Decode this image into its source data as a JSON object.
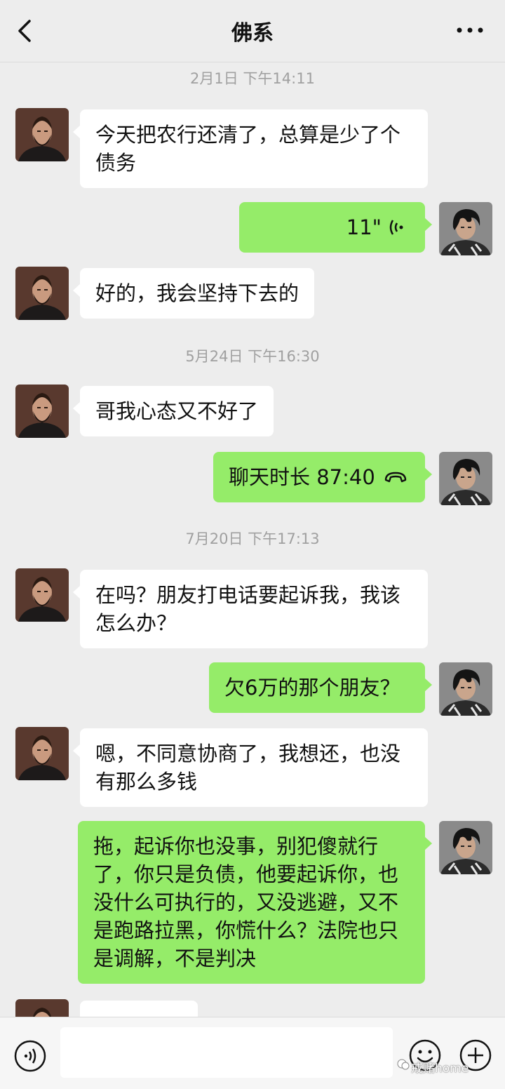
{
  "header": {
    "title": "佛系"
  },
  "timestamps": [
    "2月1日 下午14:11",
    "5月24日 下午16:30",
    "7月20日 下午17:13"
  ],
  "messages": [
    {
      "side": "in",
      "type": "text",
      "text": "今天把农行还清了，总算是少了个债务"
    },
    {
      "side": "out",
      "type": "voice",
      "duration": "11\""
    },
    {
      "side": "in",
      "type": "text",
      "text": "好的，我会坚持下去的"
    },
    {
      "side": "in",
      "type": "text",
      "text": "哥我心态又不好了"
    },
    {
      "side": "out",
      "type": "call",
      "text": "聊天时长 87:40"
    },
    {
      "side": "in",
      "type": "text",
      "text": "在吗？朋友打电话要起诉我，我该怎么办？"
    },
    {
      "side": "out",
      "type": "text",
      "text": "欠6万的那个朋友？"
    },
    {
      "side": "in",
      "type": "text",
      "text": "嗯，不同意协商了，我想还，也没有那么多钱"
    },
    {
      "side": "out",
      "type": "text",
      "text": "拖，起诉你也没事，别犯傻就行了，你只是负债，他要起诉你，也没什么可执行的，又没逃避，又不是跑路拉黑，你慌什么？法院也只是调解，不是判决"
    }
  ],
  "watermark": "戒赌home",
  "colors": {
    "background": "#ededed",
    "out_bubble": "#95ec69",
    "in_bubble": "#ffffff",
    "timestamp": "#a0a0a0"
  },
  "icons": [
    "back-icon",
    "more-icon",
    "voice-wave-icon",
    "phone-hangup-icon",
    "voice-toggle-icon",
    "emoji-icon",
    "plus-icon"
  ]
}
